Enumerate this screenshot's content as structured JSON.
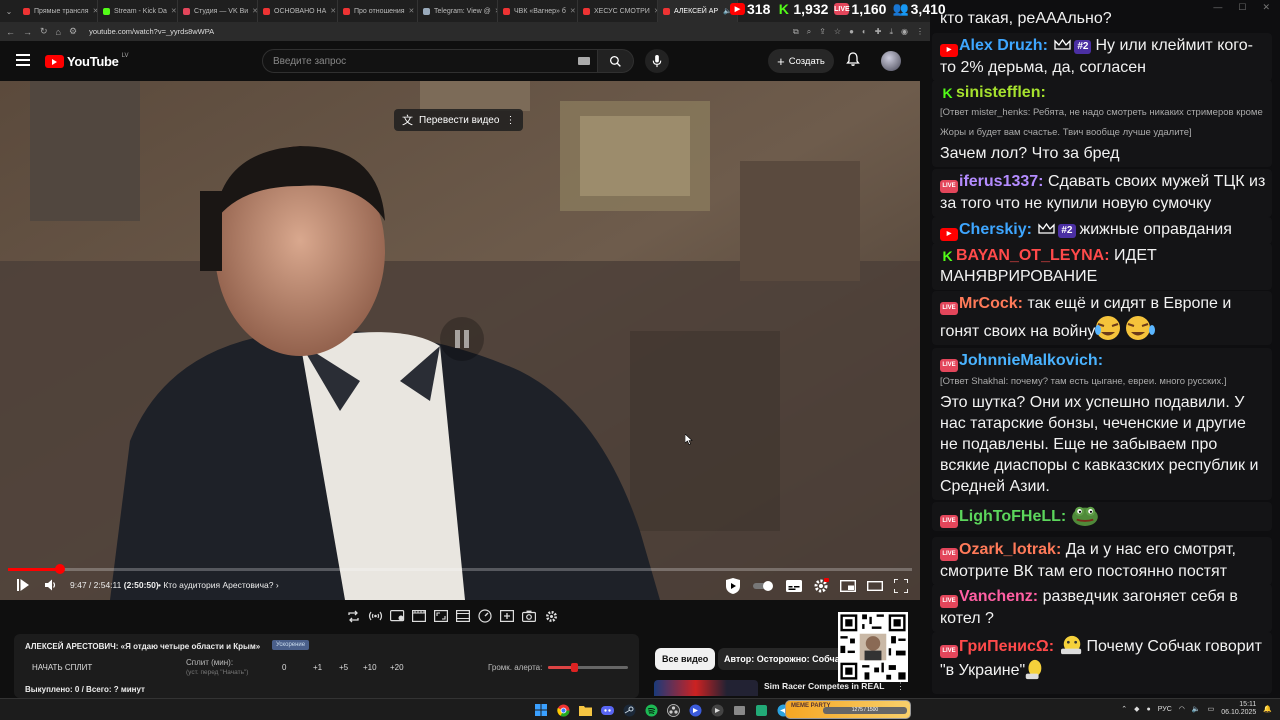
{
  "browser": {
    "tabs": [
      {
        "title": "Прямые трансля",
        "color": "#e33",
        "active": false
      },
      {
        "title": "Stream - Kick Da",
        "color": "#53fc18",
        "active": false
      },
      {
        "title": "Студия — VK Ви",
        "color": "#e3465b",
        "active": false
      },
      {
        "title": "ОСНОВАНО НА",
        "color": "#e33",
        "active": false
      },
      {
        "title": "Про отношения",
        "color": "#e33",
        "active": false
      },
      {
        "title": "Telegram: View @",
        "color": "#9ab",
        "active": false
      },
      {
        "title": "ЧВК «Вагнер» б",
        "color": "#e33",
        "active": false
      },
      {
        "title": "ХЕСУС СМОТРИ",
        "color": "#e33",
        "active": false
      },
      {
        "title": "АЛЕКСЕЙ АР",
        "color": "#e33",
        "active": true
      }
    ],
    "url": "youtube.com/watch?v=_yyrds8wWPA"
  },
  "stats": {
    "youtube": "318",
    "kick": "1,932",
    "vk": "1,160",
    "total": "3,410"
  },
  "youtube": {
    "logo_text": "YouTube",
    "logo_country": "LV",
    "search_placeholder": "Введите запрос",
    "create_label": "Создать",
    "translate_label": "Перевести видео"
  },
  "player": {
    "progress_fraction": 0.058,
    "time": "9:47 / 2:54:11",
    "time_rate": "(2:50:50)",
    "chapter": "Кто аудитория Арестовича?"
  },
  "split": {
    "title": "АЛЕКСЕЙ АРЕСТОВИЧ: «Я отдаю четыре области и Крым»",
    "badge": "Ускорение",
    "start_label": "НАЧАТЬ СПЛИТ",
    "minutes_label": "Сплит (мин):",
    "minutes_hint": "(уст. перед \"Начать\")",
    "values": [
      "0",
      "+1",
      "+5",
      "+10",
      "+20"
    ],
    "alert_label": "Громк. алерта:",
    "alert_level": 0.32,
    "summary": "Выкуплено: 0 / Всего: ? минут"
  },
  "related": {
    "chip_all": "Все видео",
    "chip_author": "Автор: Осторожно: Собчак",
    "video_title": "Sim Racer Competes in REAL"
  },
  "chat": {
    "top_fragment": "кто такая, реАААльно?",
    "messages": [
      {
        "platform": "yt",
        "name": "Alex Druzh:",
        "color": "#3ea6ff",
        "crown": true,
        "rank": "#2",
        "text": "Ну или клеймит кого-то 2% дерьма, да, согласен"
      },
      {
        "platform": "kick",
        "name": "sinistefflen:",
        "color": "#a6e22e",
        "reply": "[Ответ mister_henks: Ребята, не надо смотреть никаких стримеров кроме Жоры и будет вам счастье. Твич вообще лучше удалите]",
        "text": "Зачем лол? Что за бред"
      },
      {
        "platform": "vk",
        "name": "iferus1337:",
        "color": "#b48cff",
        "text": "Сдавать своих мужей ТЦК из за того что не купили новую сумочку"
      },
      {
        "platform": "yt",
        "name": "Cherskiy:",
        "color": "#3ea6ff",
        "crown": true,
        "rank": "#2",
        "text": "жижные оправдания"
      },
      {
        "platform": "kick",
        "name": "BAYAN_OT_LEYNA:",
        "color": "#ff4a4a",
        "text": "ИДЕТ МАНЯВРИРОВАНИЕ"
      },
      {
        "platform": "vk",
        "name": "MrCock:",
        "color": "#ff7a59",
        "text": "так ещё и сидят в Европе и гонят своих на войну",
        "emote": "crying"
      },
      {
        "platform": "vk",
        "name": "JohnnieMalkovich:",
        "color": "#4ab3ff",
        "reply": "[Ответ Shakhal: почему? там есть цыгане, евреи. много русских.]",
        "text": "Это шутка? Они их успешно подавили. У нас татарские бонзы, чеченские и другие не подавлены. Еще не забываем про всякие диаспоры с кавказских республик и Средней Азии."
      },
      {
        "platform": "vk",
        "name": "LighToFHeLL:",
        "color": "#5cd65c",
        "text": "",
        "emote": "pepe"
      },
      {
        "platform": "vk",
        "name": "Ozark_lotrak:",
        "color": "#ff7a59",
        "text": "Да и у нас его смотрят, смотрите ВК там его постоянно постят"
      },
      {
        "platform": "vk",
        "name": "Vanchenz:",
        "color": "#ff5fa2",
        "text": "разведчик загоняет себя в котел ?"
      },
      {
        "platform": "vk",
        "name": "ГриПенисΩ:",
        "color": "#ff4a4a",
        "text_pre": "",
        "text": "Почему Собчак говорит \"в Украине\"",
        "emote": "lol"
      }
    ]
  },
  "taskbar": {
    "game_label": "MEME PARTY",
    "game_progress": "1275 / 1500",
    "lang": "РУС",
    "time": "15:11",
    "date": "06.10.2025"
  },
  "colors": {
    "yt_red": "#ff0000",
    "kick_green": "#53fc18",
    "vk_pink": "#e3465b",
    "rank_purple": "#4b2fa3"
  }
}
